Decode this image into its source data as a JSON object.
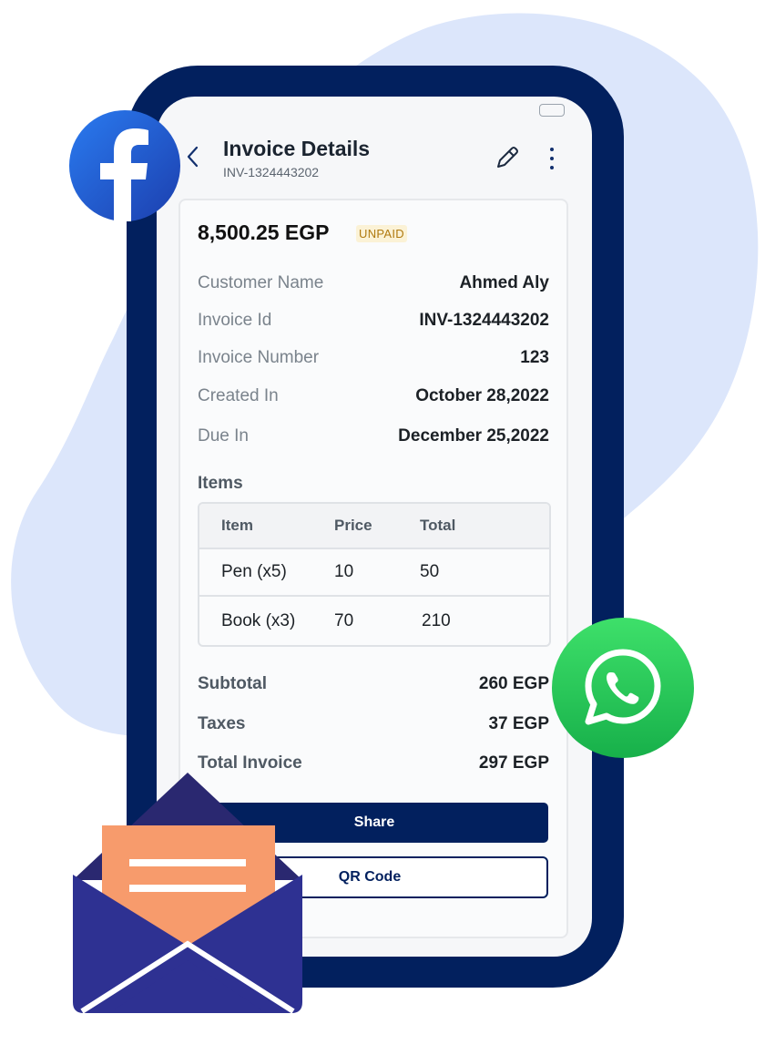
{
  "header": {
    "title": "Invoice Details",
    "invoice_ref": "INV-1324443202"
  },
  "summary": {
    "amount": "8,500.25 EGP",
    "status": "UNPAID",
    "status_color": "#b07a10"
  },
  "details": [
    {
      "label": "Customer Name",
      "value": "Ahmed Aly"
    },
    {
      "label": "Invoice Id",
      "value": "INV-1324443202"
    },
    {
      "label": "Invoice Number",
      "value": "123"
    },
    {
      "label": "Created In",
      "value": "October 28,2022"
    },
    {
      "label": "Due In",
      "value": "December 25,2022"
    }
  ],
  "items": {
    "title": "Items",
    "headers": [
      "Item",
      "Price",
      "Total"
    ],
    "rows": [
      [
        "Pen (x5)",
        "10",
        "50"
      ],
      [
        "Book (x3)",
        "70",
        "210"
      ]
    ]
  },
  "totals": [
    {
      "label": "Subtotal",
      "value": "260 EGP"
    },
    {
      "label": "Taxes",
      "value": "37 EGP"
    },
    {
      "label": "Total Invoice",
      "value": "297 EGP"
    }
  ],
  "actions": {
    "share_label": "Share",
    "qr_label": "QR Code"
  },
  "icons": {
    "back": "chevron-left-icon",
    "edit": "pencil-icon",
    "more": "more-vertical-icon",
    "facebook": "facebook-logo",
    "whatsapp": "whatsapp-logo",
    "mail": "open-envelope-icon"
  },
  "colors": {
    "brand_navy": "#02205e",
    "blob": "#dce6fb",
    "facebook": "#1f5fe0",
    "whatsapp": "#22c55e",
    "envelope": "#2e3192",
    "letter": "#f79b6c"
  }
}
